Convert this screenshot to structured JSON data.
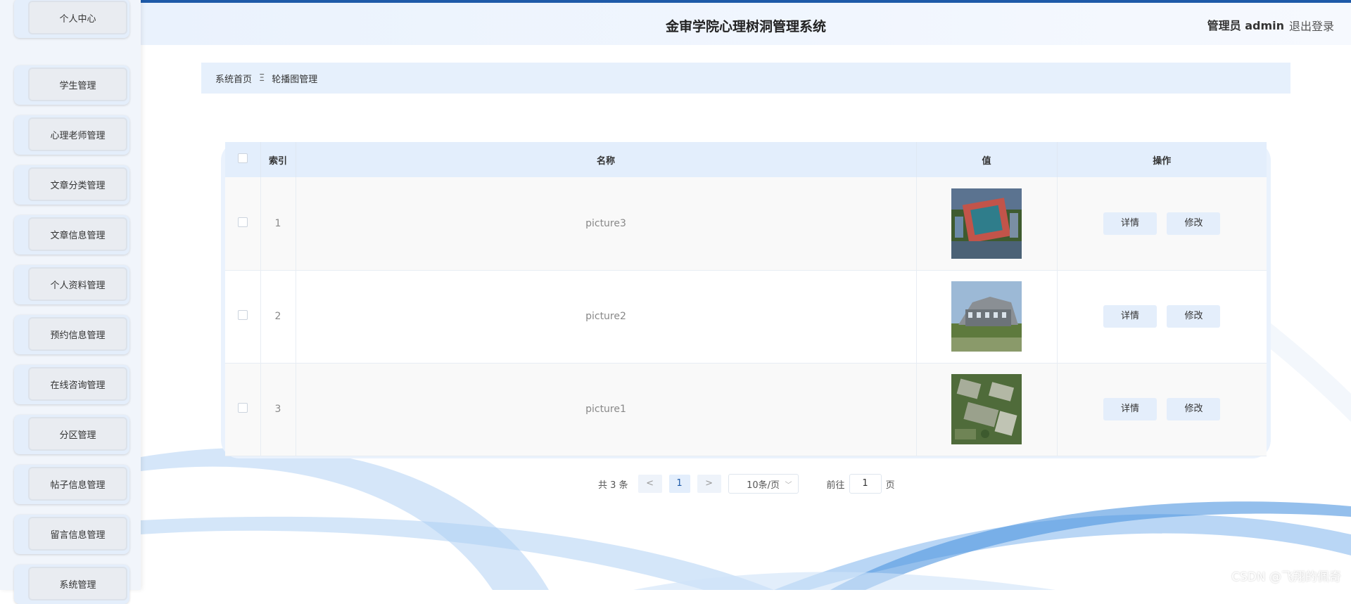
{
  "header": {
    "title": "金审学院心理树洞管理系统",
    "user_label": "管理员 admin",
    "logout": "退出登录"
  },
  "sidebar": {
    "items": [
      {
        "label": "个人中心"
      },
      {
        "label": "学生管理"
      },
      {
        "label": "心理老师管理"
      },
      {
        "label": "文章分类管理"
      },
      {
        "label": "文章信息管理"
      },
      {
        "label": "个人资料管理"
      },
      {
        "label": "预约信息管理"
      },
      {
        "label": "在线咨询管理"
      },
      {
        "label": "分区管理"
      },
      {
        "label": "帖子信息管理"
      },
      {
        "label": "留言信息管理"
      },
      {
        "label": "系统管理"
      }
    ]
  },
  "breadcrumb": {
    "home": "系统首页",
    "separator": "Ξ",
    "current": "轮播图管理"
  },
  "table": {
    "headers": {
      "index": "索引",
      "name": "名称",
      "value": "值",
      "actions": "操作"
    },
    "rows": [
      {
        "index": "1",
        "name": "picture3",
        "image": "campus-aerial-sports-field"
      },
      {
        "index": "2",
        "name": "picture2",
        "image": "campus-building-rendering"
      },
      {
        "index": "3",
        "name": "picture1",
        "image": "campus-aerial-rendering"
      }
    ],
    "detail_label": "详情",
    "edit_label": "修改"
  },
  "pagination": {
    "total": "共 3 条",
    "prev": "<",
    "page": "1",
    "next": ">",
    "page_size": "10条/页",
    "goto_label": "前往",
    "goto_value": "1",
    "page_unit": "页"
  },
  "watermark": "CSDN @飞翔的佩奇",
  "colors": {
    "accent": "#1e5aa8",
    "sidebar_bg": "#f1f5fb",
    "header_bg": "#eaf2fd",
    "button_bg": "#e4eefb"
  }
}
